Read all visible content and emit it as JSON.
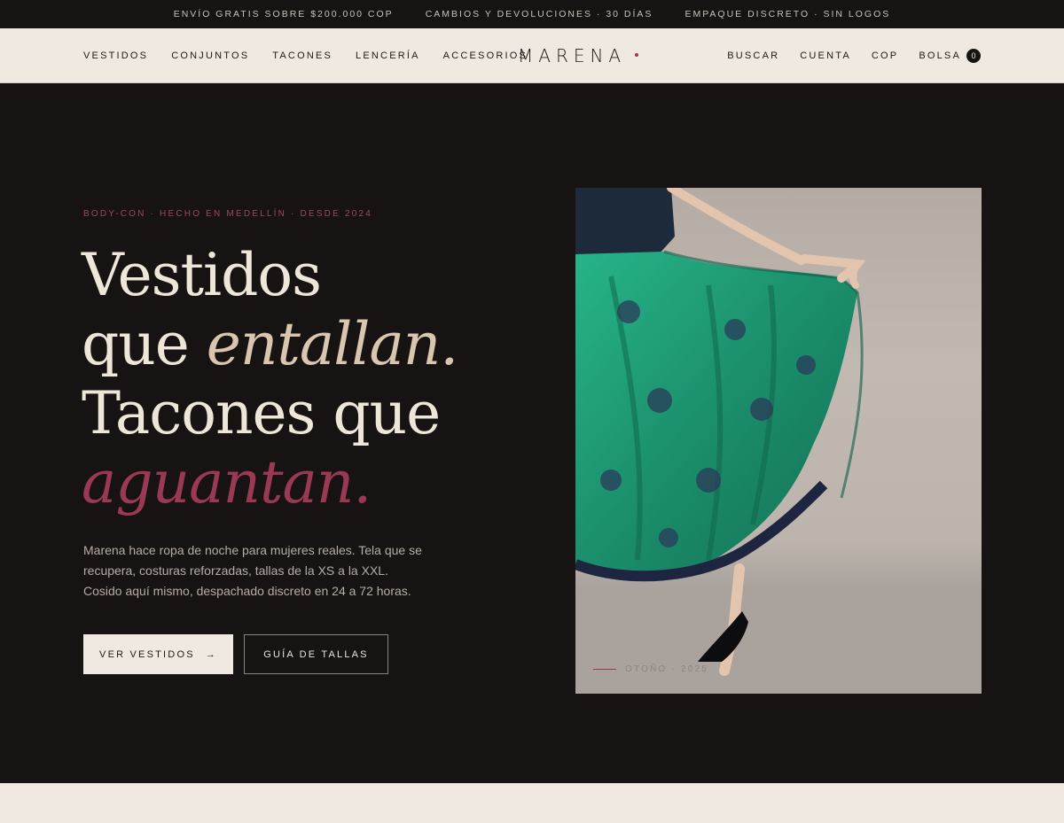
{
  "announcement": {
    "items": [
      "ENVÍO GRATIS SOBRE $200.000 COP",
      "CAMBIOS Y DEVOLUCIONES · 30 DÍAS",
      "EMPAQUE DISCRETO · SIN LOGOS"
    ]
  },
  "nav": {
    "left": [
      "VESTIDOS",
      "CONJUNTOS",
      "TACONES",
      "LENCERÍA",
      "ACCESORIOS"
    ],
    "logo": "MARENA",
    "right": {
      "search": "BUSCAR",
      "account": "CUENTA",
      "currency": "COP",
      "bag": "BOLSA",
      "bag_count": "0"
    }
  },
  "hero": {
    "eyebrow": "BODY-CON · HECHO EN MEDELLÍN · DESDE 2024",
    "headline": {
      "line1": "Vestidos",
      "line2_a": "que ",
      "line2_b": "entallan.",
      "line3": "Tacones que",
      "line4": "aguantan."
    },
    "lede": "Marena hace ropa de noche para mujeres reales. Tela que se recupera, costuras reforzadas, tallas de la XS a la XXL. Cosido aquí mismo, despachado discreto en 24 a 72 horas.",
    "cta_primary": "VER VESTIDOS",
    "cta_primary_arrow": "→",
    "cta_secondary": "GUÍA DE TALLAS",
    "photo_caption": "OTOÑO · 2025"
  },
  "colors": {
    "dark": "#171312",
    "cream": "#f0e9e1",
    "rose": "#9a3a52",
    "dress_green": "#1f9a74"
  }
}
